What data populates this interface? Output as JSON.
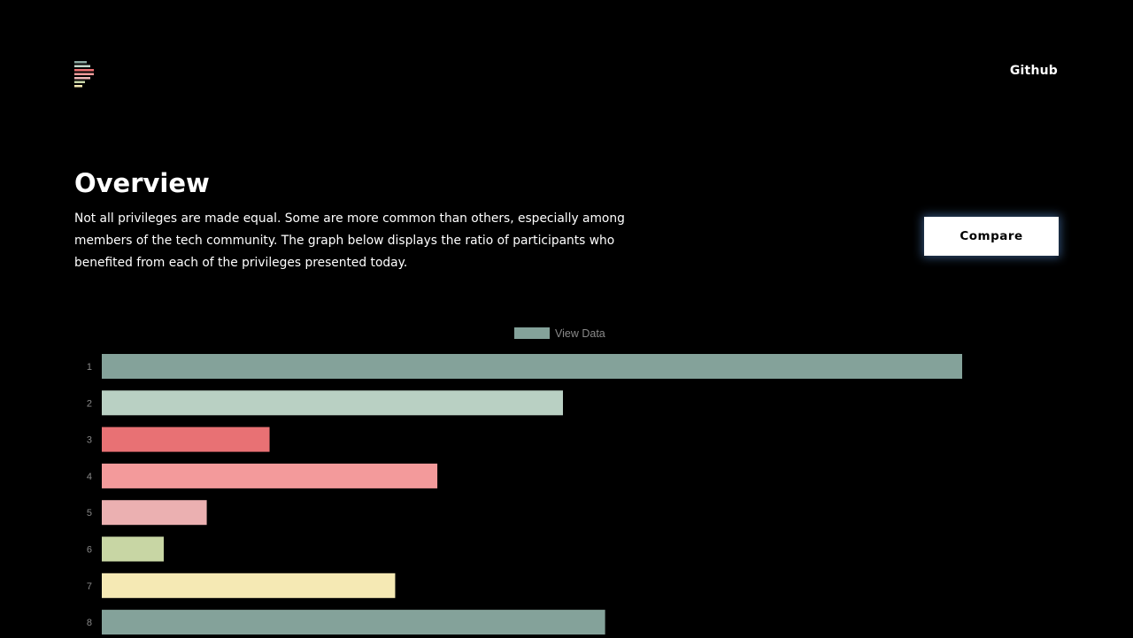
{
  "header": {
    "nav_link": "Github",
    "logo_icon": "stacked-bars-logo-icon",
    "logo_colors": [
      "#8aa69f",
      "#c3d6c8",
      "#ea6f72",
      "#ef9a9a",
      "#ecb6b6",
      "#c5d3a6",
      "#f4e8b2"
    ]
  },
  "overview": {
    "title": "Overview",
    "description": "Not all privileges are made equal. Some are more common than others, especially among members of the tech community. The graph below displays the ratio of participants who benefited from each of the privileges presented today.",
    "compare_label": "Compare"
  },
  "chart_data": {
    "type": "bar",
    "orientation": "horizontal",
    "legend": {
      "label": "View Data",
      "color": "#84a29a",
      "placement": "top-center"
    },
    "categories": [
      "1",
      "2",
      "3",
      "4",
      "5",
      "6",
      "7",
      "8"
    ],
    "values": [
      1.0,
      0.536,
      0.195,
      0.39,
      0.122,
      0.072,
      0.341,
      0.585
    ],
    "colors": [
      "#84a29a",
      "#b9d0c3",
      "#e87174",
      "#f39a9b",
      "#ebb0b1",
      "#c8d6a4",
      "#f5e9b4",
      "#84a29a"
    ],
    "xlim": [
      0,
      1
    ],
    "grid": false,
    "tick_color": "#888888"
  }
}
